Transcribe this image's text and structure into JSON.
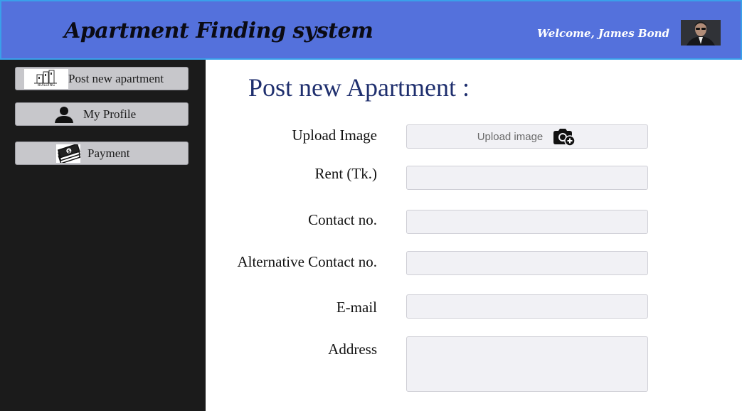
{
  "header": {
    "app_title": "Apartment Finding system",
    "welcome_text": "Welcome, James Bond"
  },
  "sidebar": {
    "items": [
      {
        "label": "Post new apartment",
        "icon": "building-icon",
        "icon_caption": "BUILDING"
      },
      {
        "label": "My Profile",
        "icon": "user-icon"
      },
      {
        "label": "Payment",
        "icon": "money-icon"
      }
    ]
  },
  "main": {
    "title": "Post new Apartment :",
    "fields": [
      {
        "label": "Upload Image",
        "type": "upload",
        "button_text": "Upload image",
        "icon": "camera-plus-icon"
      },
      {
        "label": "Rent (Tk.)",
        "type": "text",
        "value": ""
      },
      {
        "label": "Contact no.",
        "type": "text",
        "value": ""
      },
      {
        "label": "Alternative Contact no.",
        "type": "text",
        "value": ""
      },
      {
        "label": "E-mail",
        "type": "text",
        "value": ""
      },
      {
        "label": "Address",
        "type": "textarea",
        "value": ""
      }
    ]
  },
  "colors": {
    "header_bg": "#5471dc",
    "header_border": "#3aa0ea",
    "sidebar_bg": "#1b1b1b",
    "sidebar_button_bg": "#c7c7cb",
    "title_color": "#1f2f6e",
    "field_bg": "#f1f1f5"
  }
}
